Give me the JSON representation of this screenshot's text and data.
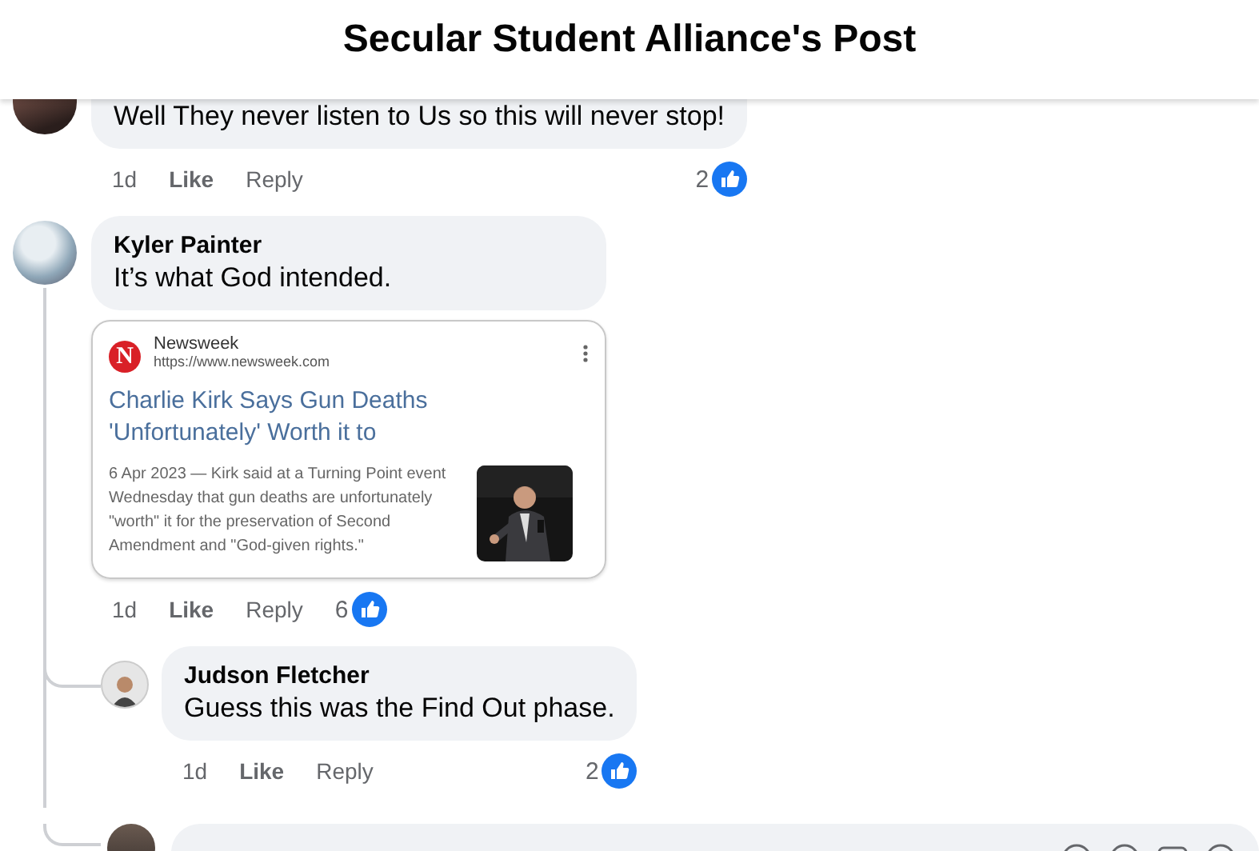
{
  "header": {
    "title": "Secular Student Alliance's Post"
  },
  "comments": [
    {
      "text": "Well They never listen to Us so this will never stop!",
      "time": "1d",
      "like": "Like",
      "reply": "Reply",
      "reaction_count": "2"
    },
    {
      "name": "Kyler Painter",
      "text": "It’s what God intended.",
      "attachment": {
        "logo": "N",
        "source": "Newsweek",
        "url": "https://www.newsweek.com",
        "headline": "Charlie Kirk Says Gun Deaths 'Unfortunately' Worth it to",
        "snippet": "6 Apr 2023 — Kirk said at a Turning Point event Wednesday that gun deaths are unfortunately \"worth\" it for the preservation of Second Amendment and \"God-given rights.\""
      },
      "time": "1d",
      "like": "Like",
      "reply": "Reply",
      "reaction_count": "6",
      "reply_box": true,
      "replies": [
        {
          "name": "Judson Fletcher",
          "text": "Guess this was the Find Out phase.",
          "time": "1d",
          "like": "Like",
          "reply": "Reply",
          "reaction_count": "2"
        }
      ]
    }
  ]
}
